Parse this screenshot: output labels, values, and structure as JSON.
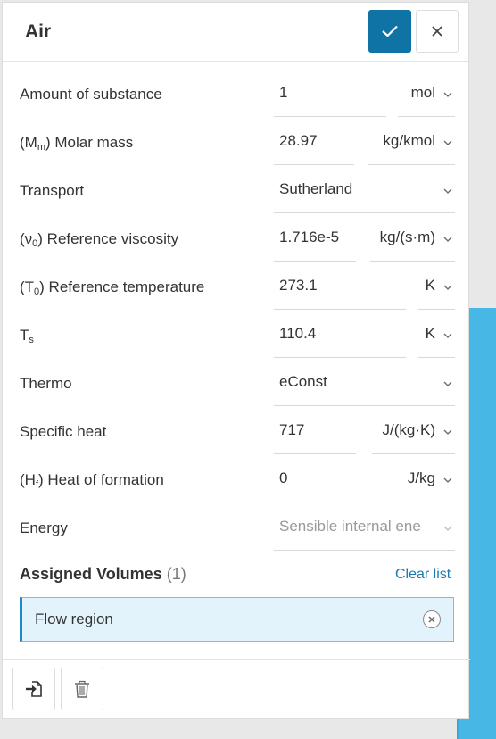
{
  "panel": {
    "title": "Air"
  },
  "rows": [
    {
      "label_pre": "Amount of substance",
      "label_sub": "",
      "label_post": "",
      "value": "1",
      "unit": "mol"
    },
    {
      "label_pre": "(M",
      "label_sub": "m",
      "label_post": ") Molar mass",
      "value": "28.97",
      "unit": "kg/kmol"
    },
    {
      "label_pre": "Transport",
      "label_sub": "",
      "label_post": "",
      "value": "Sutherland",
      "unit": ""
    },
    {
      "label_pre": "(ν",
      "label_sub": "0",
      "label_post": ") Reference viscosity",
      "value": "1.716e-5",
      "unit": "kg/(s·m)"
    },
    {
      "label_pre": "(T",
      "label_sub": "0",
      "label_post": ") Reference temperature",
      "value": "273.1",
      "unit": "K"
    },
    {
      "label_pre": "T",
      "label_sub": "s",
      "label_post": "",
      "value": "110.4",
      "unit": "K"
    },
    {
      "label_pre": "Thermo",
      "label_sub": "",
      "label_post": "",
      "value": "eConst",
      "unit": ""
    },
    {
      "label_pre": "Specific heat",
      "label_sub": "",
      "label_post": "",
      "value": "717",
      "unit": "J/(kg·K)"
    },
    {
      "label_pre": "(H",
      "label_sub": "f",
      "label_post": ") Heat of formation",
      "value": "0",
      "unit": "J/kg"
    },
    {
      "label_pre": "Energy",
      "label_sub": "",
      "label_post": "",
      "value": "Sensible internal ene",
      "unit": ""
    }
  ],
  "assigned": {
    "title": "Assigned Volumes",
    "count": "(1)",
    "clear_label": "Clear list",
    "items": [
      "Flow region"
    ]
  },
  "icons": {
    "confirm": "check-icon",
    "close": "close-icon",
    "import": "import-icon",
    "delete": "trash-icon"
  },
  "colors": {
    "accent": "#0f73a6",
    "link": "#1a7ab0",
    "selection_bg": "#e3f3fb"
  }
}
